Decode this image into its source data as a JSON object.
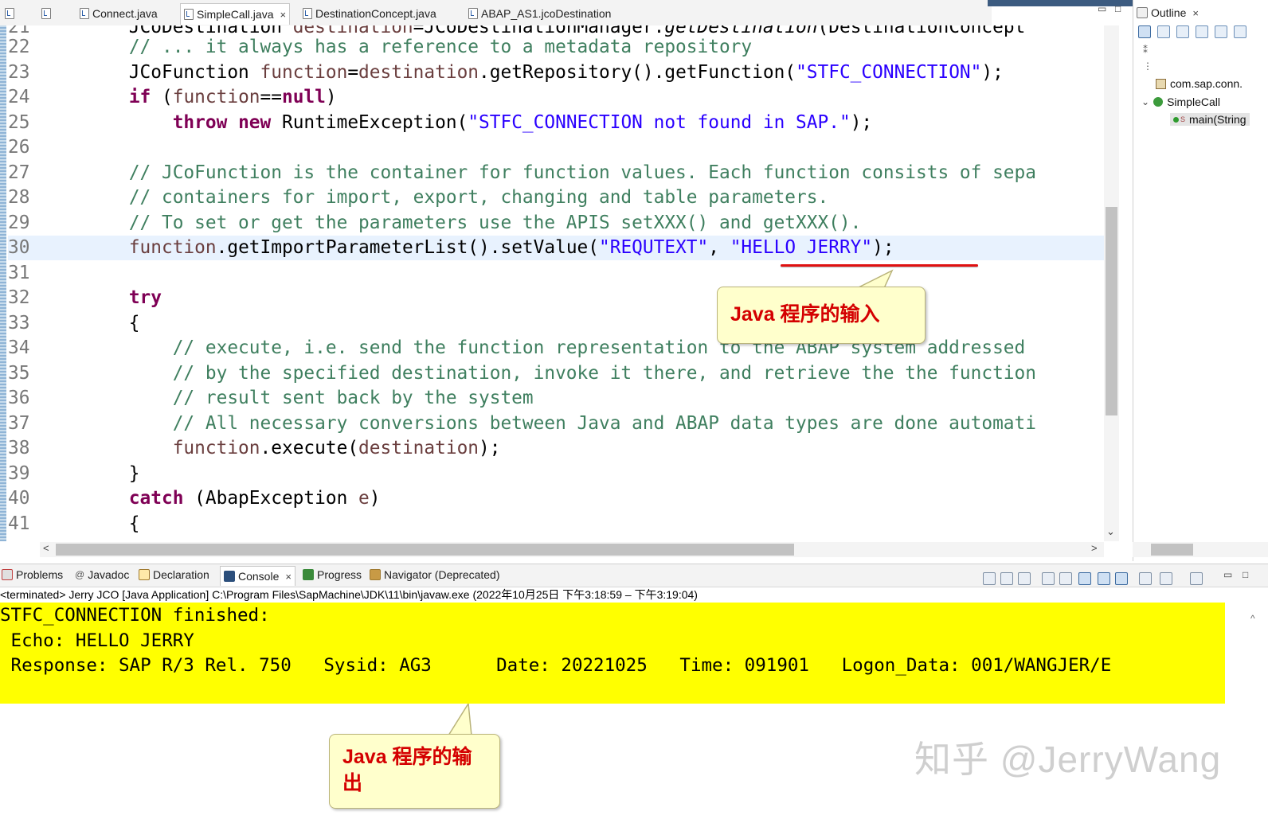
{
  "editor_tabs": [
    {
      "label": "Connect.java"
    },
    {
      "label": "SimpleCall.java",
      "close": "×"
    },
    {
      "label": "DestinationConcept.java"
    },
    {
      "label": "ABAP_AS1.jcoDestination"
    }
  ],
  "editor": {
    "lines": [
      {
        "num": "22",
        "parts": [
          {
            "t": "        "
          },
          {
            "t": "// ... it always has a reference to a metadata repository",
            "c": "cm"
          }
        ]
      },
      {
        "num": "23",
        "parts": [
          {
            "t": "        JCoFunction "
          },
          {
            "t": "function",
            "c": "vr"
          },
          {
            "t": "="
          },
          {
            "t": "destination",
            "c": "vr"
          },
          {
            "t": ".getRepository().getFunction("
          },
          {
            "t": "\"STFC_CONNECTION\"",
            "c": "st"
          },
          {
            "t": ");"
          }
        ]
      },
      {
        "num": "24",
        "parts": [
          {
            "t": "        "
          },
          {
            "t": "if",
            "c": "kw"
          },
          {
            "t": " ("
          },
          {
            "t": "function",
            "c": "vr"
          },
          {
            "t": "=="
          },
          {
            "t": "null",
            "c": "kw"
          },
          {
            "t": ")"
          }
        ]
      },
      {
        "num": "25",
        "parts": [
          {
            "t": "            "
          },
          {
            "t": "throw",
            "c": "kw"
          },
          {
            "t": " "
          },
          {
            "t": "new",
            "c": "kw"
          },
          {
            "t": " RuntimeException("
          },
          {
            "t": "\"STFC_CONNECTION not found in SAP.\"",
            "c": "st"
          },
          {
            "t": ");"
          }
        ]
      },
      {
        "num": "26",
        "parts": [
          {
            "t": ""
          }
        ]
      },
      {
        "num": "27",
        "parts": [
          {
            "t": "        "
          },
          {
            "t": "// JCoFunction is the container for function values. Each function consists of sepa",
            "c": "cm"
          }
        ]
      },
      {
        "num": "28",
        "parts": [
          {
            "t": "        "
          },
          {
            "t": "// containers for import, export, changing and table parameters.",
            "c": "cm"
          }
        ]
      },
      {
        "num": "29",
        "parts": [
          {
            "t": "        "
          },
          {
            "t": "// To set or get the parameters use the APIS setXXX() and getXXX().",
            "c": "cm"
          }
        ]
      },
      {
        "num": "30",
        "hl": true,
        "parts": [
          {
            "t": "        "
          },
          {
            "t": "function",
            "c": "vr"
          },
          {
            "t": ".getImportParameterList().setValue("
          },
          {
            "t": "\"REQUTEXT\"",
            "c": "st"
          },
          {
            "t": ", "
          },
          {
            "t": "\"HELLO JERRY\"",
            "c": "st"
          },
          {
            "t": ");"
          }
        ]
      },
      {
        "num": "31",
        "parts": [
          {
            "t": ""
          }
        ]
      },
      {
        "num": "32",
        "parts": [
          {
            "t": "        "
          },
          {
            "t": "try",
            "c": "kw"
          }
        ]
      },
      {
        "num": "33",
        "parts": [
          {
            "t": "        {"
          }
        ]
      },
      {
        "num": "34",
        "parts": [
          {
            "t": "            "
          },
          {
            "t": "// execute, i.e. send the function representation to the ABAP system addressed",
            "c": "cm"
          }
        ]
      },
      {
        "num": "35",
        "parts": [
          {
            "t": "            "
          },
          {
            "t": "// by the specified destination, invoke it there, and retrieve the the function",
            "c": "cm"
          }
        ]
      },
      {
        "num": "36",
        "parts": [
          {
            "t": "            "
          },
          {
            "t": "// result sent back by the system",
            "c": "cm"
          }
        ]
      },
      {
        "num": "37",
        "parts": [
          {
            "t": "            "
          },
          {
            "t": "// All necessary conversions between Java and ABAP data types are done automati",
            "c": "cm"
          }
        ]
      },
      {
        "num": "38",
        "parts": [
          {
            "t": "            "
          },
          {
            "t": "function",
            "c": "vr"
          },
          {
            "t": ".execute("
          },
          {
            "t": "destination",
            "c": "vr"
          },
          {
            "t": ");"
          }
        ]
      },
      {
        "num": "39",
        "parts": [
          {
            "t": "        }"
          }
        ]
      },
      {
        "num": "40",
        "parts": [
          {
            "t": "        "
          },
          {
            "t": "catch",
            "c": "kw"
          },
          {
            "t": " (AbapException "
          },
          {
            "t": "e",
            "c": "vr"
          },
          {
            "t": ")"
          }
        ]
      },
      {
        "num": "41",
        "parts": [
          {
            "t": "        {"
          }
        ]
      }
    ]
  },
  "outline": {
    "tab_label": "Outline",
    "close": "×",
    "items": [
      {
        "label": "com.sap.conn."
      },
      {
        "label": "SimpleCall"
      },
      {
        "label": "main(String"
      }
    ]
  },
  "callouts": {
    "input": "Java 程序的输入",
    "output_line1": "Java 程序的输",
    "output_line2": "出"
  },
  "bottom_tabs": [
    {
      "label": "Problems"
    },
    {
      "label": "Javadoc"
    },
    {
      "label": "Declaration"
    },
    {
      "label": "Console",
      "close": "×"
    },
    {
      "label": "Progress"
    },
    {
      "label": "Navigator (Deprecated)"
    }
  ],
  "console": {
    "status": "<terminated> Jerry JCO [Java Application] C:\\Program Files\\SapMachine\\JDK\\11\\bin\\javaw.exe  (2022年10月25日 下午3:18:59 – 下午3:19:04)",
    "lines": [
      "STFC_CONNECTION finished:",
      " Echo: HELLO JERRY",
      " Response: SAP R/3 Rel. 750   Sysid: AG3      Date: 20221025   Time: 091901   Logon_Data: 001/WANGJER/E"
    ]
  },
  "watermark": "知乎 @JerryWang",
  "colors": {
    "keyword": "#7f0055",
    "comment": "#3f7f5f",
    "string": "#2a00ff",
    "console_highlight": "#ffff00",
    "callout_text": "#d40000",
    "callout_bg": "#ffffcc"
  }
}
